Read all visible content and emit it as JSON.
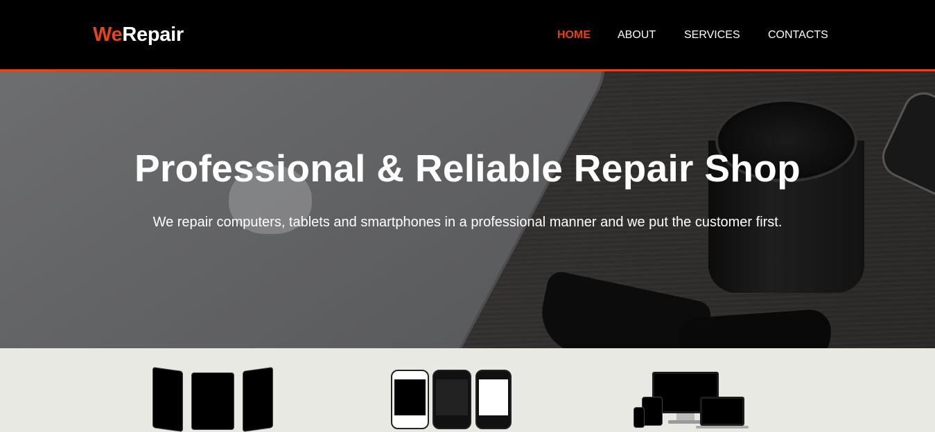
{
  "brand": {
    "part1": "We",
    "part2": "Repair"
  },
  "nav": {
    "items": [
      {
        "label": "HOME",
        "active": true
      },
      {
        "label": "ABOUT",
        "active": false
      },
      {
        "label": "SERVICES",
        "active": false
      },
      {
        "label": "CONTACTS",
        "active": false
      }
    ]
  },
  "hero": {
    "title": "Professional & Reliable Repair Shop",
    "subtitle": "We repair computers, tablets and smartphones in a professional manner and we put the customer first."
  },
  "colors": {
    "accent": "#e0461c",
    "header_bg": "#000000",
    "section_bg": "#e9e9e4"
  },
  "devices": {
    "groups": [
      {
        "icon": "tablets-icon"
      },
      {
        "icon": "smartphones-icon"
      },
      {
        "icon": "computers-icon"
      }
    ]
  }
}
